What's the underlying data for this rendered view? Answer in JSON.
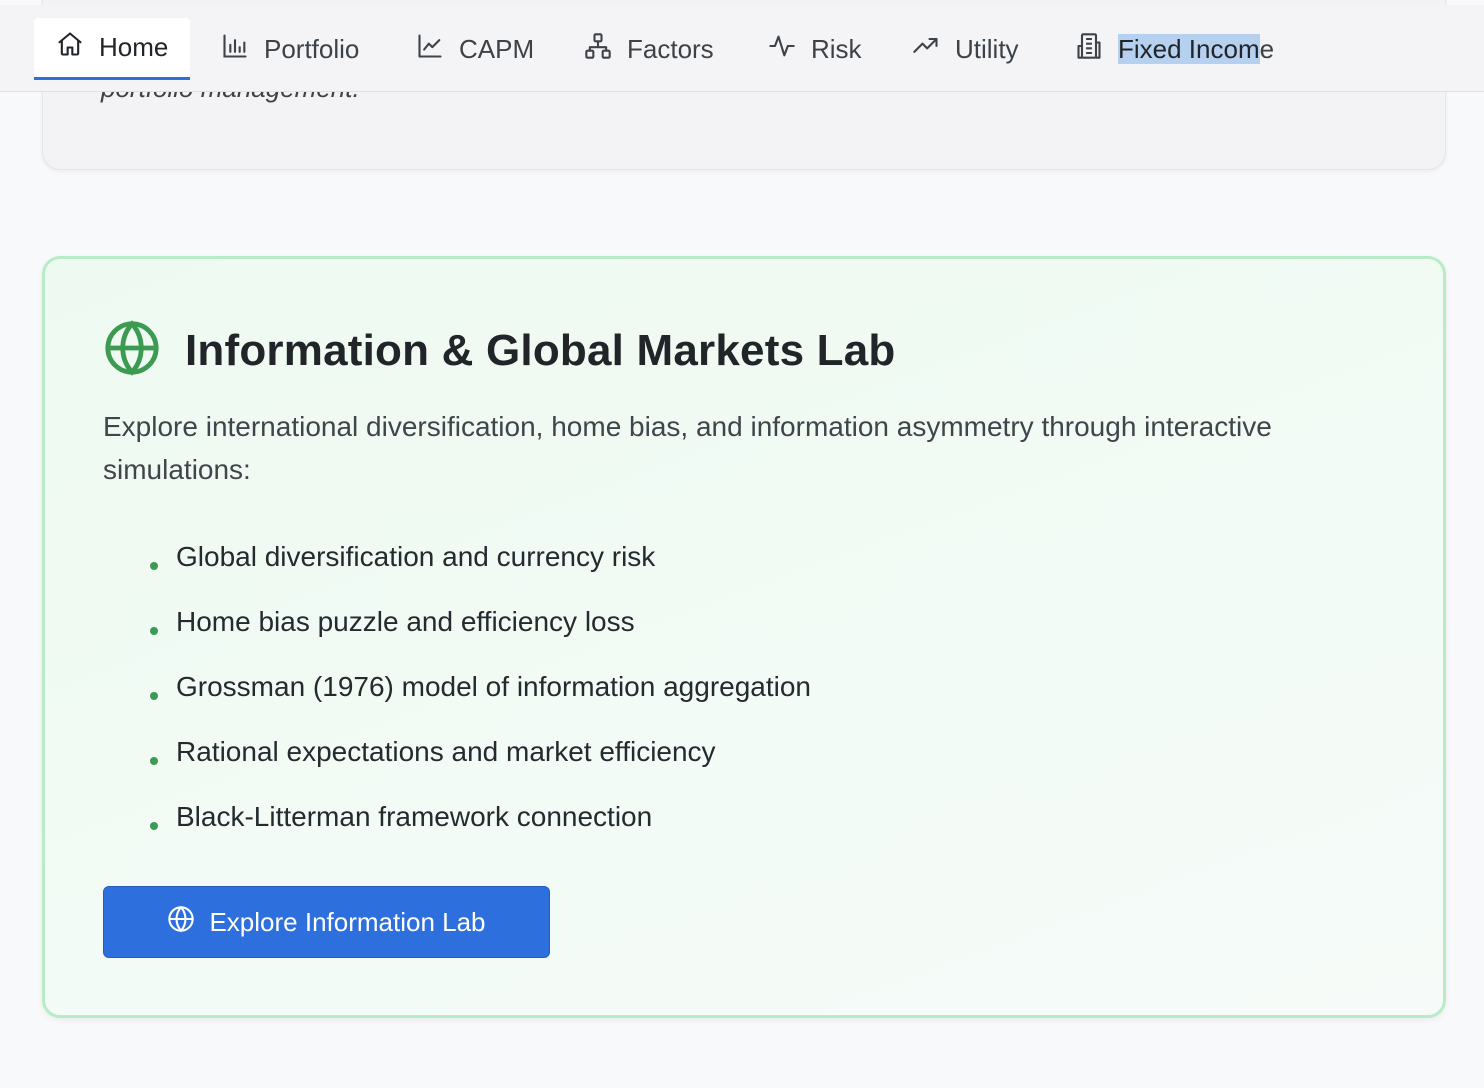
{
  "nav": {
    "items": [
      {
        "label": "Home",
        "icon": "home-icon",
        "active": true
      },
      {
        "label": "Portfolio",
        "icon": "bar-chart-icon"
      },
      {
        "label": "CAPM",
        "icon": "line-chart-icon"
      },
      {
        "label": "Factors",
        "icon": "network-icon"
      },
      {
        "label": "Risk",
        "icon": "activity-icon"
      },
      {
        "label": "Utility",
        "icon": "trending-up-icon"
      },
      {
        "label": "Fixed Income",
        "icon": "building-icon",
        "selected_text": "Fixed Incom",
        "rest_text": "e"
      }
    ]
  },
  "intro": {
    "tail_text": "portfolio management."
  },
  "lab": {
    "icon": "globe-icon",
    "title": "Information & Global Markets Lab",
    "description": "Explore international diversification, home bias, and information asymmetry through interactive simulations:",
    "bullets": [
      "Global diversification and currency risk",
      "Home bias puzzle and efficiency loss",
      "Grossman (1976) model of information aggregation",
      "Rational expectations and market efficiency",
      "Black-Litterman framework connection"
    ],
    "button_label": "Explore Information Lab",
    "button_icon": "globe-icon"
  },
  "colors": {
    "accent": "#2d6fdd",
    "lab_green": "#3d9a52",
    "lab_border": "#b8ecc6"
  }
}
